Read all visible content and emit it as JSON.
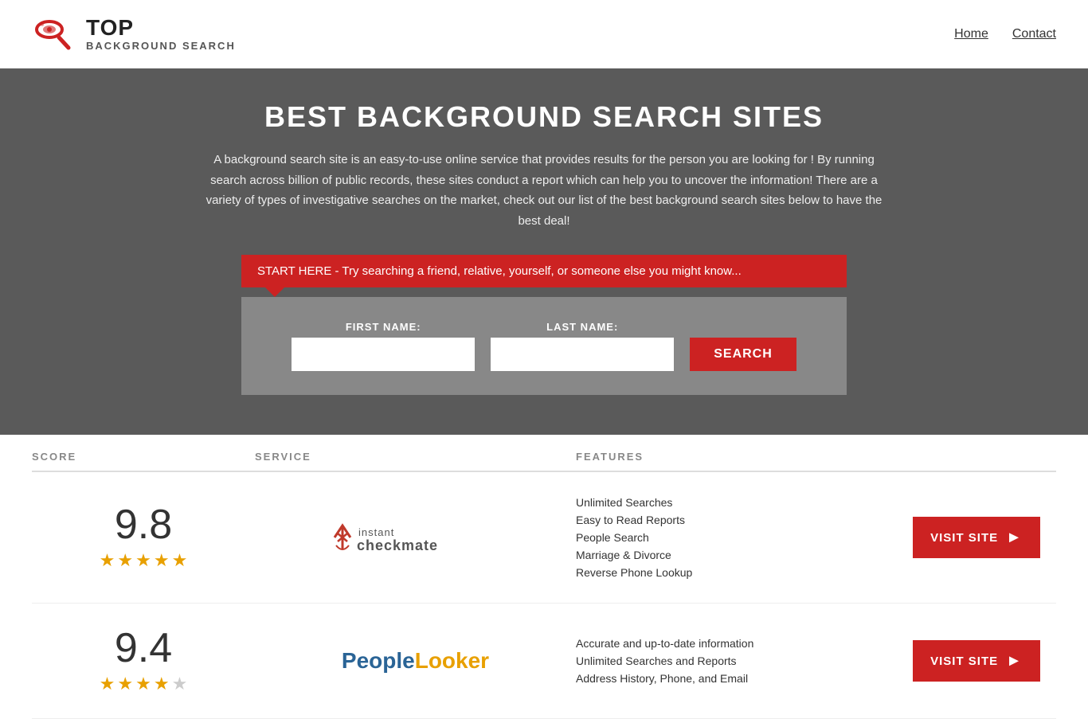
{
  "header": {
    "logo_top": "TOP",
    "logo_bottom": "BACKGROUND SEARCH",
    "nav": {
      "home": "Home",
      "contact": "Contact"
    }
  },
  "hero": {
    "title": "BEST BACKGROUND SEARCH SITES",
    "description": "A background search site is an easy-to-use online service that provides results  for the person you are looking for ! By  running  search across billion of public records, these sites conduct  a report which can help you to uncover the information! There are a variety of types of investigative searches on the market, check out our  list of the best background search sites below to have the best deal!",
    "callout": "START HERE - Try searching a friend, relative, yourself, or someone else you might know...",
    "form": {
      "first_name_label": "FIRST NAME:",
      "last_name_label": "LAST NAME:",
      "search_button": "SEARCH"
    }
  },
  "results": {
    "columns": {
      "score": "SCORE",
      "service": "SERVICE",
      "features": "FEATURES",
      "action": ""
    },
    "rows": [
      {
        "score": "9.8",
        "stars": 4.5,
        "service_name": "Instant Checkmate",
        "features": [
          "Unlimited Searches",
          "Easy to Read Reports",
          "People Search",
          "Marriage & Divorce",
          "Reverse Phone Lookup"
        ],
        "visit_label": "VISIT SITE"
      },
      {
        "score": "9.4",
        "stars": 4,
        "service_name": "PeopleLooker",
        "features": [
          "Accurate and up-to-date information",
          "Unlimited Searches and Reports",
          "Address History, Phone, and Email"
        ],
        "visit_label": "VISIT SITE"
      }
    ]
  }
}
